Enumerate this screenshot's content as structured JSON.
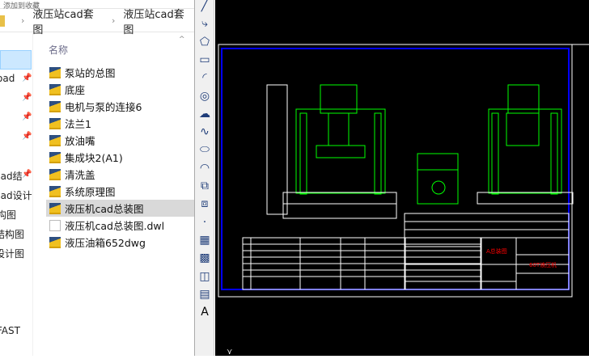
{
  "explorer": {
    "top_strip": "添加到收藏",
    "breadcrumb": [
      "液压站cad套图",
      "液压站cad套图"
    ],
    "nav_items": [
      "oad",
      "cad结",
      "cad设计",
      "构图",
      "结构图",
      "设计图",
      "FAST"
    ],
    "column_header": "名称",
    "files": [
      {
        "name": "泵站的总图",
        "type": "folder"
      },
      {
        "name": "底座",
        "type": "folder"
      },
      {
        "name": "电机与泵的连接6",
        "type": "folder"
      },
      {
        "name": "法兰1",
        "type": "folder"
      },
      {
        "name": "放油嘴",
        "type": "folder"
      },
      {
        "name": "集成块2(A1)",
        "type": "folder"
      },
      {
        "name": "清洗盖",
        "type": "folder"
      },
      {
        "name": "系统原理图",
        "type": "folder"
      },
      {
        "name": "液压机cad总装图",
        "type": "folder",
        "selected": true
      },
      {
        "name": "液压机cad总装图.dwl",
        "type": "file"
      },
      {
        "name": "液压油箱652dwg",
        "type": "folder"
      }
    ]
  },
  "toolbar": {
    "tools": [
      "line-icon",
      "polyline-icon",
      "polygon-icon",
      "rectangle-icon",
      "arc-icon",
      "circle-icon",
      "revcloud-icon",
      "spline-icon",
      "ellipse-icon",
      "ellipse-arc-icon",
      "insert-block-icon",
      "make-block-icon",
      "point-icon",
      "hatch-icon",
      "gradient-icon",
      "region-icon",
      "table-icon",
      "text-icon"
    ]
  },
  "drawing": {
    "title_block_name": "A总装图",
    "title_block_drawing": "60T液压机",
    "colors": {
      "frame": "#0000ff",
      "parts": "#00ff00",
      "title_text": "#ff0000",
      "table_text": "#ff00ff",
      "lines": "#ffffff"
    }
  }
}
